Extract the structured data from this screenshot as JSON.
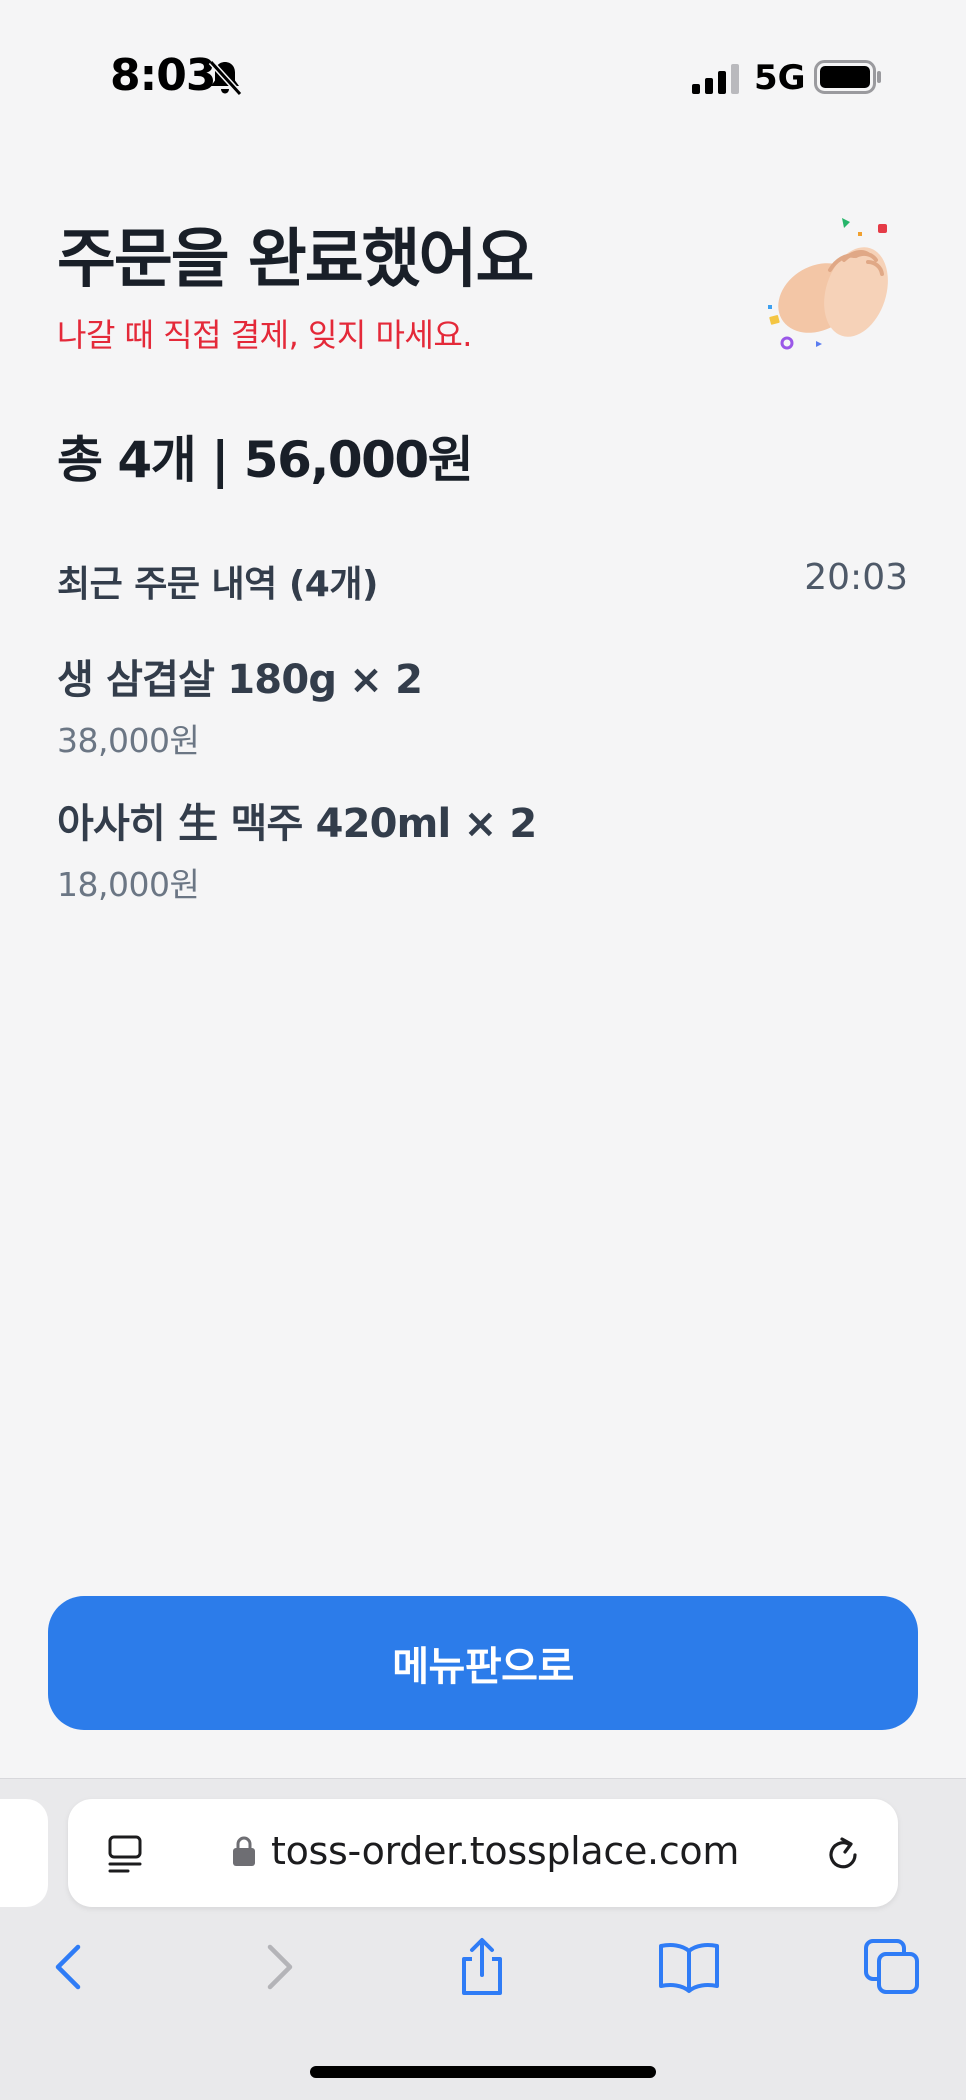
{
  "status_bar": {
    "time": "8:03",
    "network": "5G",
    "icons": [
      "bell-muted-icon",
      "signal-icon",
      "battery-icon"
    ]
  },
  "order_complete": {
    "title": "주문을 완료했어요",
    "subtitle": "나갈 때 직접 결제, 잊지 마세요.",
    "title_emoji_icon": "clapping-hands-icon",
    "total": "총 4개 | 56,000원",
    "recent_history_label": "최근 주문 내역 (4개)",
    "recent_history_time": "20:03",
    "items": [
      {
        "name": "생 삼겹살 180g × 2",
        "price": "38,000원"
      },
      {
        "name": "아사히 生 맥주 420ml × 2",
        "price": "18,000원"
      }
    ],
    "menu_button_label": "메뉴판으로"
  },
  "browser": {
    "url": "toss-order.tossplace.com",
    "toolbar_icons": [
      "back-icon",
      "forward-icon",
      "share-icon",
      "bookmarks-icon",
      "tabs-icon"
    ]
  },
  "colors": {
    "accent": "#2c7cea",
    "warning_text": "#e42939",
    "background": "#f5f5f6"
  }
}
